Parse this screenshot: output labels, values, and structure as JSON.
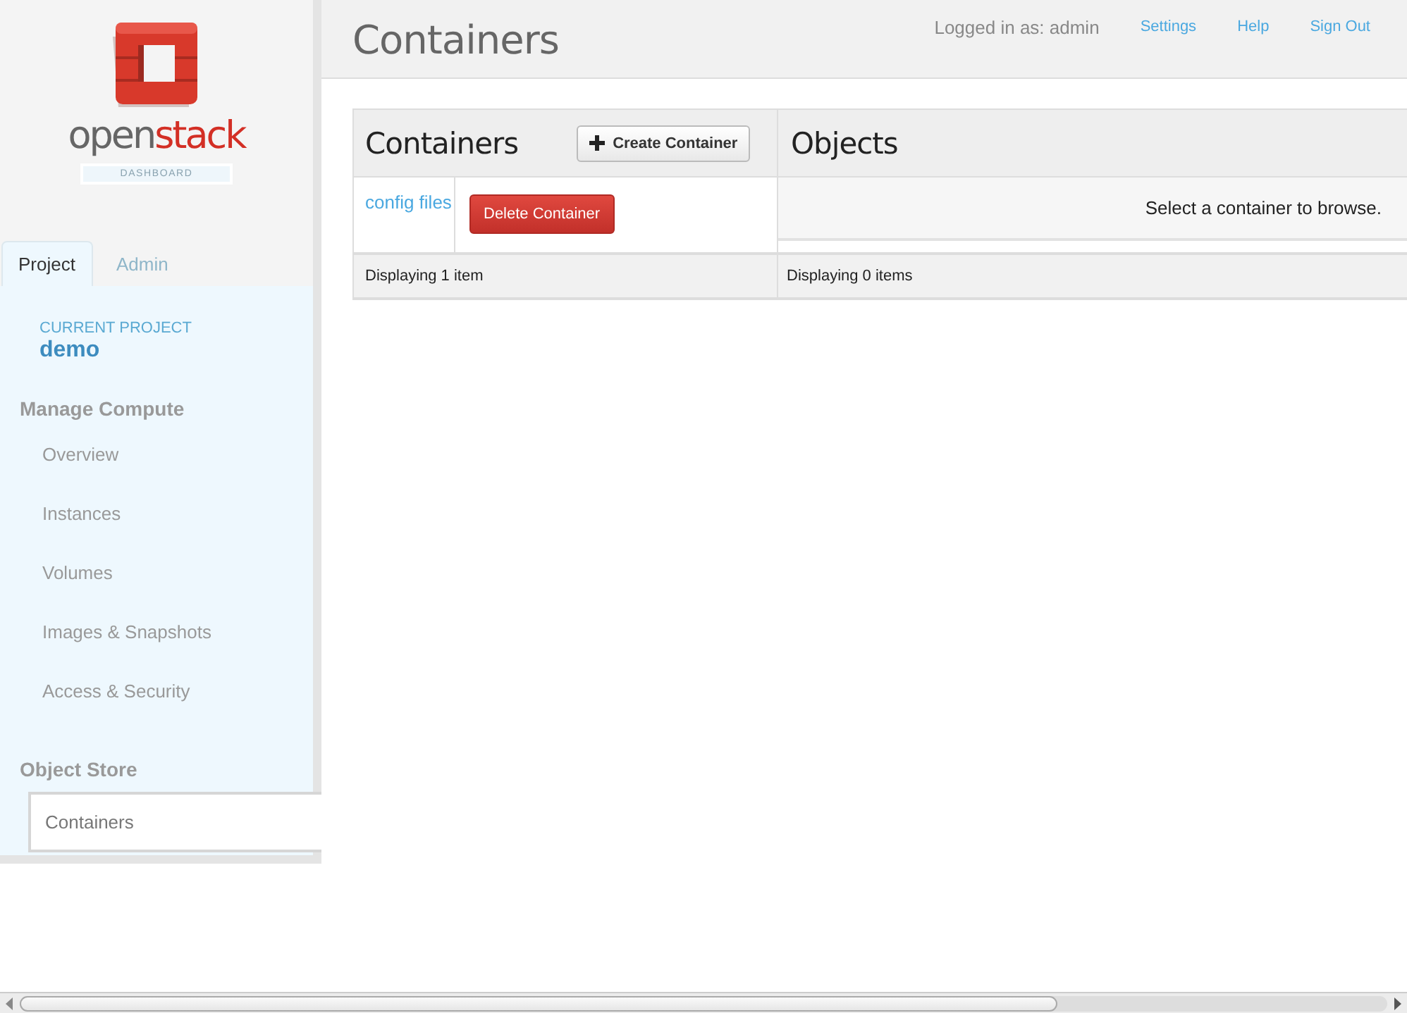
{
  "logo": {
    "wordmark": [
      "open",
      "stack"
    ],
    "subtitle": "DASHBOARD"
  },
  "tabs": [
    {
      "label": "Project",
      "selected": true
    },
    {
      "label": "Admin",
      "selected": false
    }
  ],
  "current_project": {
    "label": "CURRENT PROJECT",
    "name": "demo"
  },
  "nav": [
    {
      "title": "Manage Compute",
      "items": [
        {
          "label": "Overview",
          "selected": false
        },
        {
          "label": "Instances",
          "selected": false
        },
        {
          "label": "Volumes",
          "selected": false
        },
        {
          "label": "Images & Snapshots",
          "selected": false
        },
        {
          "label": "Access & Security",
          "selected": false
        }
      ]
    },
    {
      "title": "Object Store",
      "items": [
        {
          "label": "Containers",
          "selected": true
        }
      ]
    }
  ],
  "header": {
    "title": "Containers",
    "user_text": "Logged in as: admin",
    "links": [
      "Settings",
      "Help",
      "Sign Out"
    ]
  },
  "containers_panel": {
    "title": "Containers",
    "create_button": "Create Container",
    "rows": [
      {
        "name": "config files",
        "action": "Delete Container"
      }
    ],
    "footer": "Displaying 1 item"
  },
  "objects_panel": {
    "title": "Objects",
    "message": "Select a container to browse.",
    "footer": "Displaying 0 items"
  }
}
